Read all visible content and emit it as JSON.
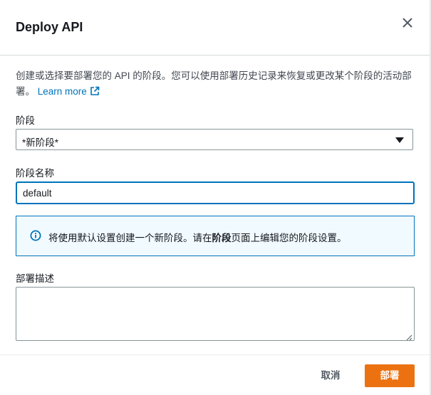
{
  "dialog": {
    "title": "Deploy API",
    "close_icon": "close-icon"
  },
  "description": {
    "text": "创建或选择要部署您的 API 的阶段。您可以使用部署历史记录来恢复或更改某个阶段的活动部署。",
    "learn_more": "Learn more",
    "learn_more_icon": "external-link-icon"
  },
  "stage": {
    "label": "阶段",
    "selected": "*新阶段*"
  },
  "stage_name": {
    "label": "阶段名称",
    "value": "default"
  },
  "info_alert": {
    "icon": "info-icon",
    "text_before": "将使用默认设置创建一个新阶段。请在",
    "text_bold": "阶段",
    "text_after": "页面上编辑您的阶段设置。"
  },
  "deployment_description": {
    "label": "部署描述",
    "value": ""
  },
  "footer": {
    "cancel_label": "取消",
    "deploy_label": "部署"
  },
  "colors": {
    "primary_button": "#ec7211",
    "link": "#0073bb",
    "info_border": "#0073bb",
    "info_background": "#f1faff"
  }
}
